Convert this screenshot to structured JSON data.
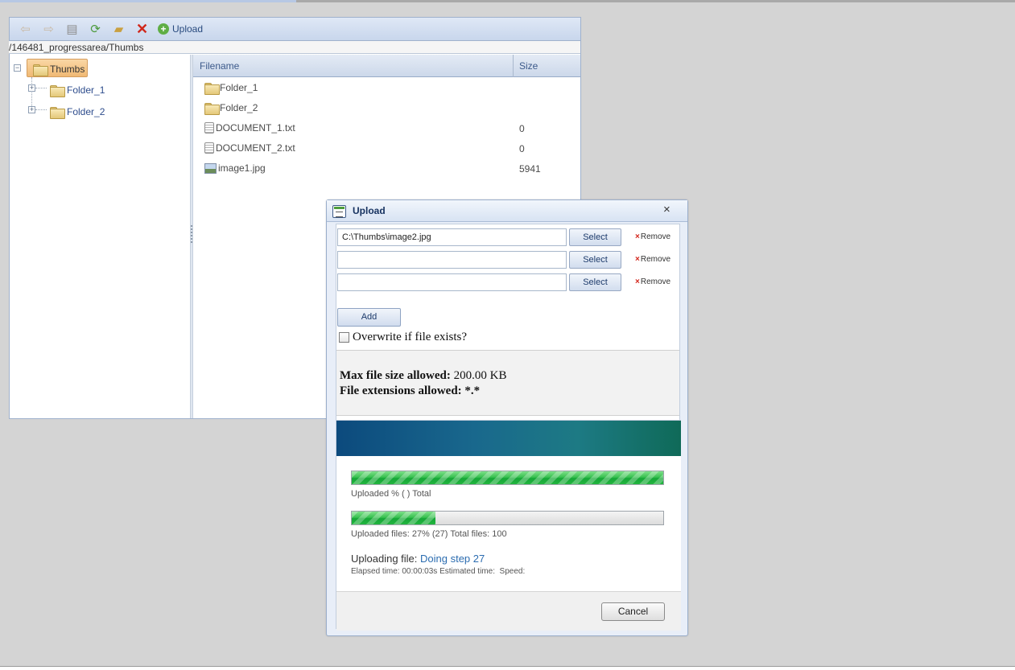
{
  "explorer": {
    "toolbar": {
      "back_icon": "back-arrow-icon",
      "forward_icon": "forward-arrow-icon",
      "open_icon": "document-icon",
      "refresh_icon": "refresh-icon",
      "new_folder_icon": "new-folder-icon",
      "delete_icon": "delete-icon",
      "upload_label": "Upload"
    },
    "path": "/146481_progressarea/Thumbs",
    "tree": {
      "root": "Thumbs",
      "children": [
        "Folder_1",
        "Folder_2"
      ]
    },
    "grid": {
      "columns": [
        "Filename",
        "Size"
      ],
      "rows": [
        {
          "name": "Folder_1",
          "size": "",
          "type": "folder"
        },
        {
          "name": "Folder_2",
          "size": "",
          "type": "folder"
        },
        {
          "name": "DOCUMENT_1.txt",
          "size": "0",
          "type": "text"
        },
        {
          "name": "DOCUMENT_2.txt",
          "size": "0",
          "type": "text"
        },
        {
          "name": "image1.jpg",
          "size": "5941",
          "type": "image"
        }
      ]
    }
  },
  "dialog": {
    "title": "Upload",
    "close_glyph": "×",
    "files": [
      {
        "value": "C:\\Thumbs\\image2.jpg",
        "select_label": "Select",
        "remove_label": "Remove"
      },
      {
        "value": "",
        "select_label": "Select",
        "remove_label": "Remove"
      },
      {
        "value": "",
        "select_label": "Select",
        "remove_label": "Remove"
      }
    ],
    "remove_glyph": "×",
    "add_label": "Add",
    "overwrite_label": "Overwrite if file exists?",
    "overwrite_checked": false,
    "limits": {
      "max_size_label": "Max file size allowed:",
      "max_size_value": "200.00 KB",
      "extensions_label": "File extensions allowed:",
      "extensions_value": "*.*"
    },
    "progress": {
      "total_percent": 100,
      "total_label": "Uploaded % ( ) Total",
      "files_percent": 27,
      "files_label": "Uploaded files: 27% (27) Total files: 100",
      "uploading_label": "Uploading file:",
      "uploading_step": "Doing step 27",
      "timing": "Elapsed time: 00:00:03s Estimated time:  Speed:",
      "cancel_label": "Cancel"
    }
  },
  "colors": {
    "accent": "#2b6cb0",
    "progress_green": "#16a637",
    "remove_red": "#d3261c",
    "banner_start": "#0c4a7d",
    "banner_end": "#0f6a58"
  }
}
